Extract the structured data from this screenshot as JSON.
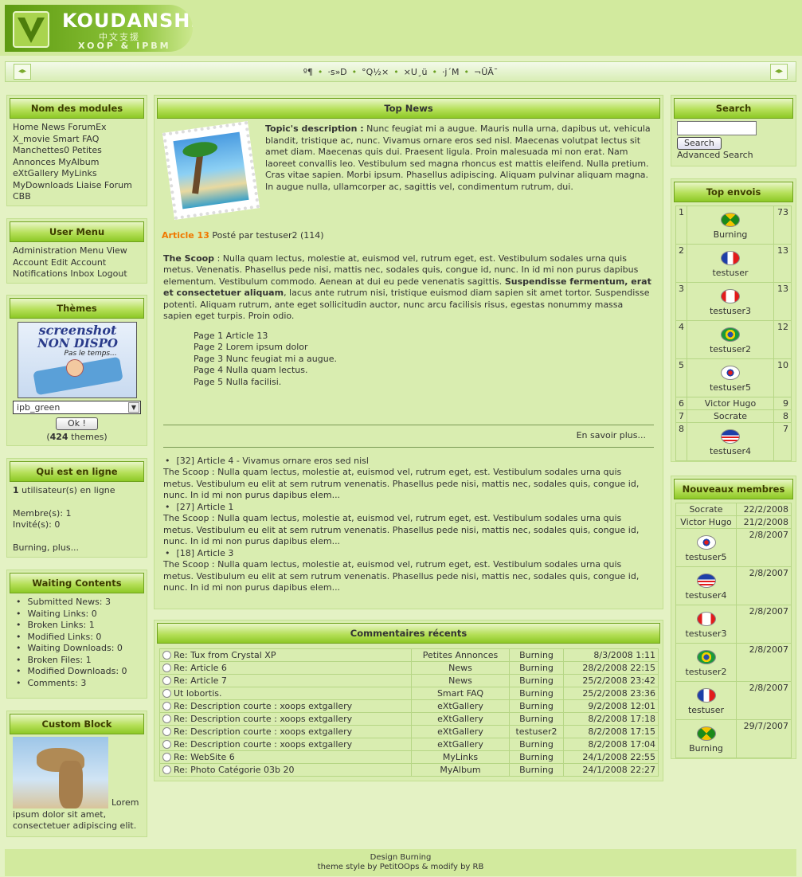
{
  "header": {
    "logo_title": "KOUDANSHI",
    "logo_sub": "中文支援",
    "logo_sub2": "XOOP & IPBM",
    "nav_items": [
      "º¶",
      "·s»D",
      "°Q½×",
      "×U¸ü",
      "·j´M",
      "¬ÛÃ¯"
    ]
  },
  "left": {
    "modules": {
      "title": "Nom des modules",
      "items": [
        "Home",
        "News",
        "ForumEx",
        "X_movie",
        "Smart FAQ",
        "Manchettes0",
        "Petites Annonces",
        "MyAlbum",
        "eXtGallery",
        "MyLinks",
        "MyDownloads",
        "Liaise",
        "Forum",
        "CBB"
      ]
    },
    "user_menu": {
      "title": "User Menu",
      "items": [
        "Administration Menu",
        "View Account",
        "Edit Account",
        "Notifications",
        "Inbox",
        "Logout"
      ]
    },
    "themes": {
      "title": "Thèmes",
      "select_value": "ipb_green",
      "ok_label": "Ok !",
      "count": "424",
      "count_label": "themes",
      "shot_l1": "screenshot",
      "shot_l2": "NON DISPO",
      "shot_l3": "Pas le temps..."
    },
    "online": {
      "title": "Qui est en ligne",
      "users_count": "1",
      "users_label": "utilisateur(s) en ligne",
      "members": "Membre(s): 1",
      "guests": "Invité(s): 0",
      "names": "Burning, plus..."
    },
    "waiting": {
      "title": "Waiting Contents",
      "items": [
        "Submitted News: 3",
        "Waiting Links: 0",
        "Broken Links: 1",
        "Modified Links: 0",
        "Waiting Downloads: 0",
        "Broken Files: 1",
        "Modified Downloads: 0",
        "Comments: 3"
      ]
    },
    "custom": {
      "title": "Custom Block",
      "text": "Lorem ipsum dolor sit amet, consectetuer adipiscing elit."
    }
  },
  "center": {
    "top_news": {
      "title": "Top News",
      "topic_label": "Topic's description :",
      "topic_text": "Nunc feugiat mi a augue. Mauris nulla urna, dapibus ut, vehicula blandit, tristique ac, nunc. Vivamus ornare eros sed nisl. Maecenas volutpat lectus sit amet diam. Maecenas quis dui. Praesent ligula. Proin malesuada mi non erat. Nam laoreet convallis leo. Vestibulum sed magna rhoncus est mattis eleifend. Nulla pretium. Cras vitae sapien. Morbi ipsum. Phasellus adipiscing. Aliquam pulvinar aliquam magna. In augue nulla, ullamcorper ac, sagittis vel, condimentum rutrum, dui.",
      "article_link": "Article 13",
      "article_meta": "Posté par testuser2 (114)",
      "scoop_label": "The Scoop",
      "scoop_text1": ": Nulla quam lectus, molestie at, euismod vel, rutrum eget, est. Vestibulum sodales urna quis metus. Venenatis. Phasellus pede nisi, mattis nec, sodales quis, congue id, nunc. In id mi non purus dapibus elementum. Vestibulum commodo. Aenean at dui eu pede venenatis sagittis.",
      "scoop_bold": "Suspendisse fermentum, erat et consectetuer aliquam",
      "scoop_text2": ", lacus ante rutrum nisi, tristique euismod diam sapien sit amet tortor. Suspendisse potenti. Aliquam rutrum, ante eget sollicitudin auctor, nunc arcu facilisis risus, egestas nonummy massa sapien eget turpis. Proin odio.",
      "pages": [
        "Page 1 Article 13",
        "Page 2 Lorem ipsum dolor",
        "Page 3 Nunc feugiat mi a augue.",
        "Page 4 Nulla quam lectus.",
        "Page 5 Nulla facilisi."
      ],
      "more": "En savoir plus...",
      "list": [
        {
          "title": "[32] Article 4 - Vivamus ornare eros sed nisl",
          "text": "The Scoop : Nulla quam lectus, molestie at, euismod vel, rutrum eget, est. Vestibulum sodales urna quis metus. Vestibulum eu elit at sem rutrum venenatis. Phasellus pede nisi, mattis nec, sodales quis, congue id, nunc. In id mi non purus dapibus elem..."
        },
        {
          "title": "[27] Article 1",
          "text": "The Scoop : Nulla quam lectus, molestie at, euismod vel, rutrum eget, est. Vestibulum sodales urna quis metus. Vestibulum eu elit at sem rutrum venenatis. Phasellus pede nisi, mattis nec, sodales quis, congue id, nunc. In id mi non purus dapibus elem..."
        },
        {
          "title": "[18] Article 3",
          "text": "The Scoop : Nulla quam lectus, molestie at, euismod vel, rutrum eget, est. Vestibulum sodales urna quis metus. Vestibulum eu elit at sem rutrum venenatis. Phasellus pede nisi, mattis nec, sodales quis, congue id, nunc. In id mi non purus dapibus elem..."
        }
      ]
    },
    "comments": {
      "title": "Commentaires récents",
      "rows": [
        [
          "Re: Tux from Crystal XP",
          "Petites Annonces",
          "Burning",
          "8/3/2008 1:11"
        ],
        [
          "Re: Article 6",
          "News",
          "Burning",
          "28/2/2008 22:15"
        ],
        [
          "Re: Article 7",
          "News",
          "Burning",
          "25/2/2008 23:42"
        ],
        [
          "Ut lobortis.",
          "Smart FAQ",
          "Burning",
          "25/2/2008 23:36"
        ],
        [
          "Re: Description courte : xoops extgallery",
          "eXtGallery",
          "Burning",
          "9/2/2008 12:01"
        ],
        [
          "Re: Description courte : xoops extgallery",
          "eXtGallery",
          "Burning",
          "8/2/2008 17:18"
        ],
        [
          "Re: Description courte : xoops extgallery",
          "eXtGallery",
          "testuser2",
          "8/2/2008 17:15"
        ],
        [
          "Re: Description courte : xoops extgallery",
          "eXtGallery",
          "Burning",
          "8/2/2008 17:04"
        ],
        [
          "Re: WebSite 6",
          "MyLinks",
          "Burning",
          "24/1/2008 22:55"
        ],
        [
          "Re: Photo Catégorie 03b 20",
          "MyAlbum",
          "Burning",
          "24/1/2008 22:27"
        ]
      ]
    }
  },
  "right": {
    "search": {
      "title": "Search",
      "button": "Search",
      "advanced": "Advanced Search"
    },
    "top": {
      "title": "Top envois",
      "rows": [
        {
          "rank": "1",
          "name": "Burning",
          "count": "73",
          "flag": "jamaica"
        },
        {
          "rank": "2",
          "name": "testuser",
          "count": "13",
          "flag": "france"
        },
        {
          "rank": "3",
          "name": "testuser3",
          "count": "13",
          "flag": "canada"
        },
        {
          "rank": "4",
          "name": "testuser2",
          "count": "12",
          "flag": "brazil"
        },
        {
          "rank": "5",
          "name": "testuser5",
          "count": "10",
          "flag": "korea"
        },
        {
          "rank": "6",
          "name": "Victor Hugo",
          "count": "9",
          "flag": ""
        },
        {
          "rank": "7",
          "name": "Socrate",
          "count": "8",
          "flag": ""
        },
        {
          "rank": "8",
          "name": "testuser4",
          "count": "7",
          "flag": "usa"
        }
      ]
    },
    "new": {
      "title": "Nouveaux membres",
      "rows": [
        {
          "name": "Socrate",
          "date": "22/2/2008",
          "flag": ""
        },
        {
          "name": "Victor Hugo",
          "date": "21/2/2008",
          "flag": ""
        },
        {
          "name": "testuser5",
          "date": "2/8/2007",
          "flag": "korea"
        },
        {
          "name": "testuser4",
          "date": "2/8/2007",
          "flag": "usa"
        },
        {
          "name": "testuser3",
          "date": "2/8/2007",
          "flag": "canada"
        },
        {
          "name": "testuser2",
          "date": "2/8/2007",
          "flag": "brazil"
        },
        {
          "name": "testuser",
          "date": "2/8/2007",
          "flag": "france"
        },
        {
          "name": "Burning",
          "date": "29/7/2007",
          "flag": "jamaica"
        }
      ]
    }
  },
  "footer": {
    "line1": "Design Burning",
    "line2": "theme style by PetitOOps & modify by RB"
  }
}
